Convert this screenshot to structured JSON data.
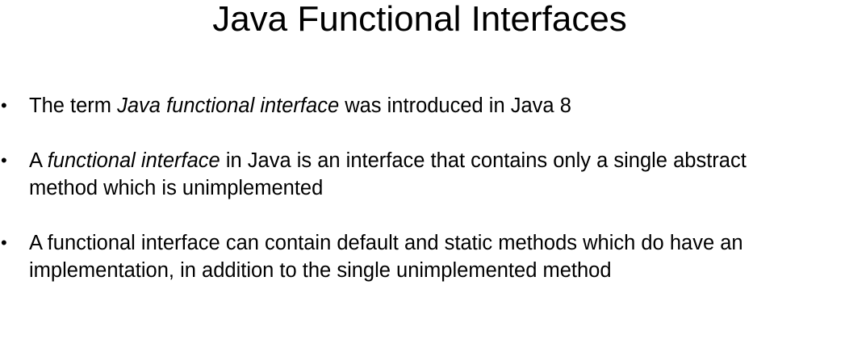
{
  "slide": {
    "title": "Java Functional Interfaces",
    "bullet_glyph": "•",
    "bullets": [
      {
        "line1_pre": "The term ",
        "line1_em": "Java functional interface",
        "line1_post": " was introduced in Java 8"
      },
      {
        "line1_pre": "A ",
        "line1_em": "functional interface",
        "line1_post": " in Java is an interface that contains only a single abstract",
        "line2": "method which is unimplemented"
      },
      {
        "line1": "A functional interface can contain default and static methods which do have an",
        "line2": "implementation, in addition to the single unimplemented method"
      }
    ]
  }
}
